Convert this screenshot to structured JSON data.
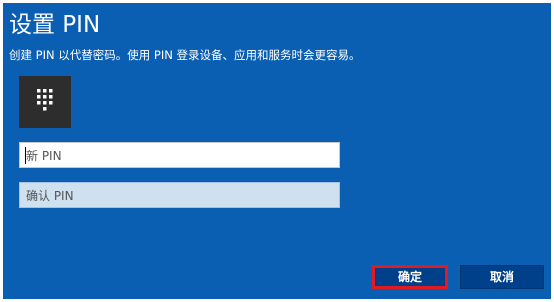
{
  "dialog": {
    "title": "设置 PIN",
    "description": "创建 PIN 以代替密码。使用 PIN 登录设备、应用和服务时会更容易。",
    "keypad_icon": "keypad-icon",
    "new_pin_placeholder": "新 PIN",
    "confirm_pin_placeholder": "确认 PIN",
    "ok_label": "确定",
    "cancel_label": "取消"
  },
  "colors": {
    "dialog_background": "#0a5fb3",
    "button_background": "#003f8a",
    "highlight_border": "#e01b24",
    "confirm_field_background": "#cfe0ef"
  }
}
